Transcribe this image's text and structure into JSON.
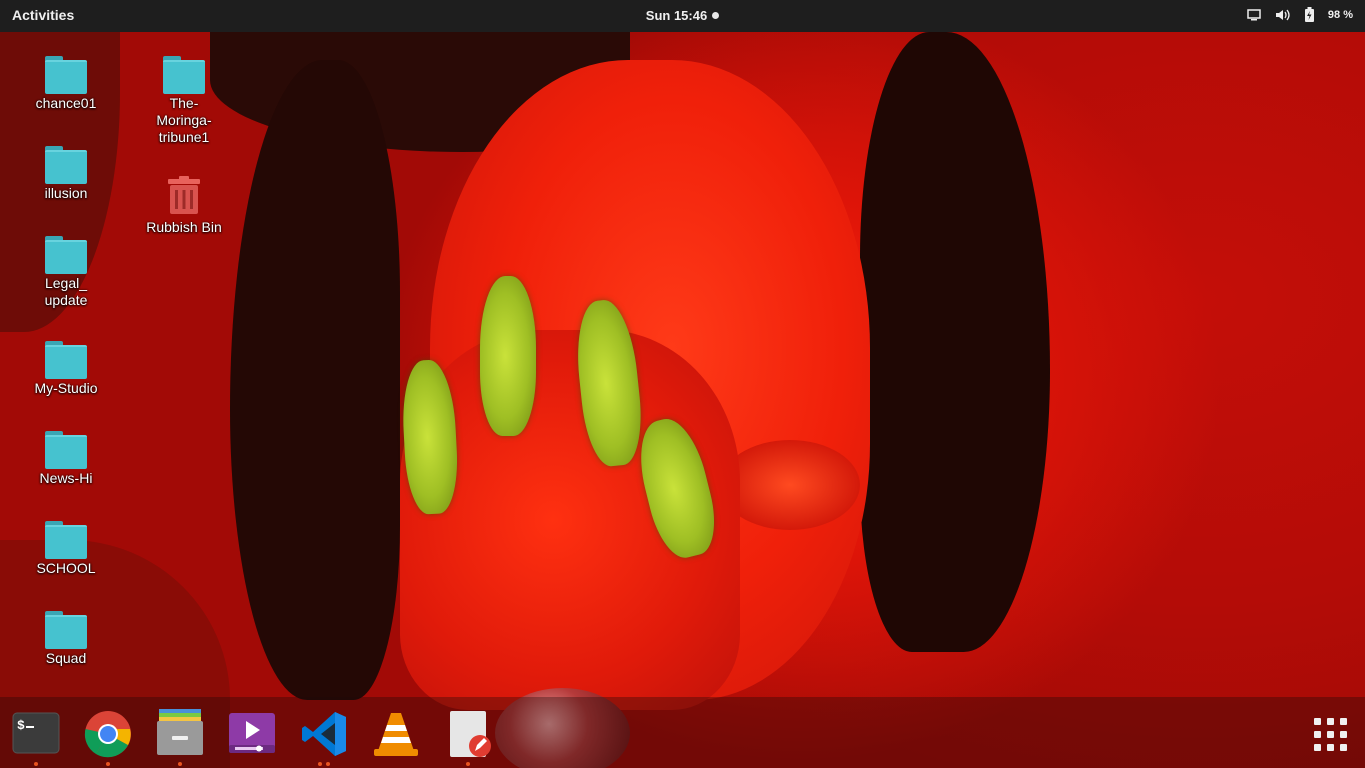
{
  "topbar": {
    "activities_label": "Activities",
    "clock": "Sun 15:46",
    "battery": "98 %",
    "icons": [
      "screen-icon",
      "volume-icon",
      "battery-icon"
    ]
  },
  "desktop": {
    "icons": [
      {
        "label": "chance01",
        "type": "folder"
      },
      {
        "label": "illusion",
        "type": "folder"
      },
      {
        "label": "Legal_ update",
        "type": "folder"
      },
      {
        "label": "My-Studio",
        "type": "folder"
      },
      {
        "label": "News-Hi",
        "type": "folder"
      },
      {
        "label": "SCHOOL",
        "type": "folder"
      },
      {
        "label": "Squad",
        "type": "folder"
      },
      {
        "label": "The-Moringa-tribune1",
        "type": "folder"
      },
      {
        "label": "Rubbish Bin",
        "type": "trash"
      }
    ]
  },
  "dock": {
    "apps": [
      {
        "name": "Terminal",
        "icon": "terminal-icon",
        "running": true
      },
      {
        "name": "Google Chrome",
        "icon": "chrome-icon",
        "running": true
      },
      {
        "name": "Files",
        "icon": "files-icon",
        "running": true
      },
      {
        "name": "Video Player",
        "icon": "video-player-icon",
        "running": false
      },
      {
        "name": "Visual Studio Code",
        "icon": "vscode-icon",
        "running": true
      },
      {
        "name": "VLC",
        "icon": "vlc-icon",
        "running": false
      },
      {
        "name": "Text Editor",
        "icon": "text-editor-icon",
        "running": true
      }
    ],
    "show_apps_icon": "grid-icon"
  },
  "colors": {
    "topbar": "#1e1e1e",
    "folder": "#46c2cf",
    "trash": "#d9534f",
    "accent": "#e95420",
    "wallpaper": "#c80e08"
  }
}
